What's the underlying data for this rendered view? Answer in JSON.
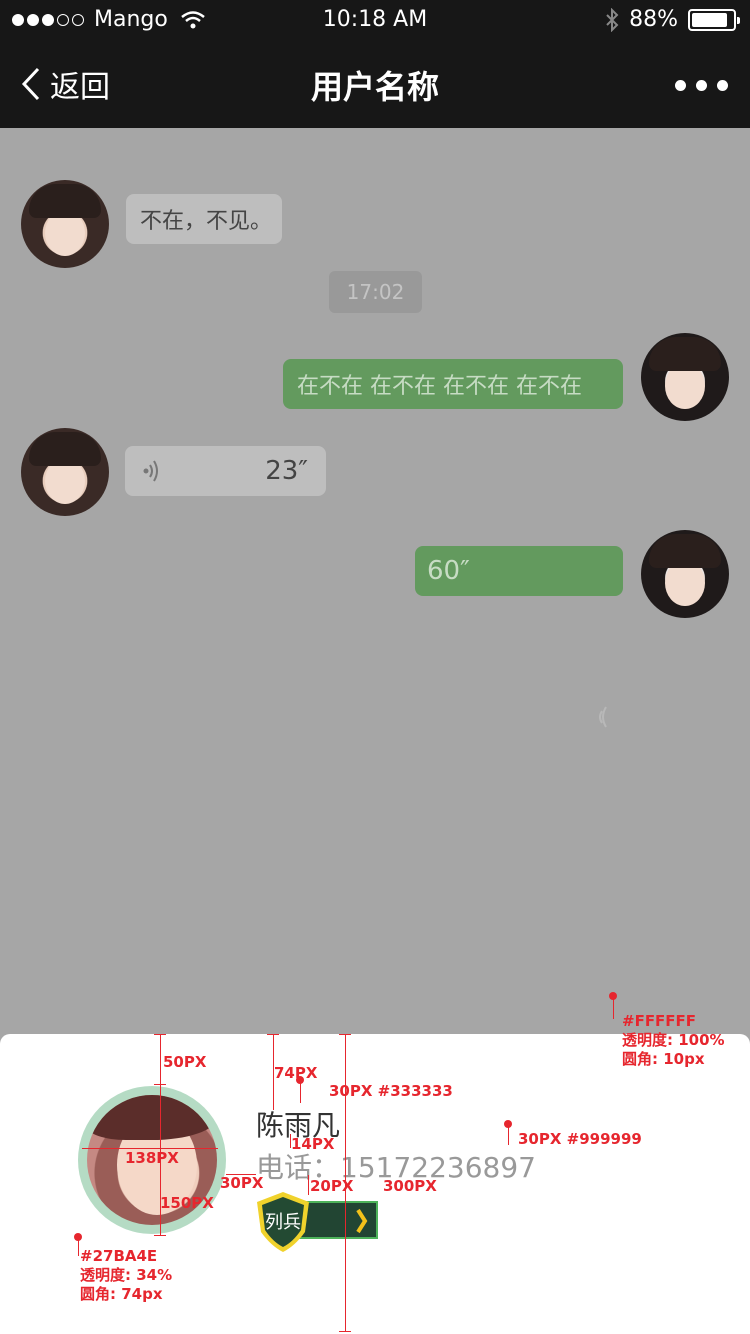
{
  "status_bar": {
    "carrier": "Mango",
    "signal_dots": [
      true,
      true,
      true,
      false,
      false
    ],
    "time": "10:18 AM",
    "battery": "88%",
    "battery_level": 0.88
  },
  "nav": {
    "back_label": "返回",
    "title": "用户名称"
  },
  "chat": {
    "timestamp": "17:02",
    "messages": [
      {
        "side": "in",
        "type": "text",
        "text": "不在，不见。"
      },
      {
        "side": "out",
        "type": "text",
        "text": "在不在 在不在 在不在 在不在"
      },
      {
        "side": "in",
        "type": "voice",
        "duration": "23″"
      },
      {
        "side": "out",
        "type": "voice",
        "duration": "60″"
      }
    ]
  },
  "profile_card": {
    "name": "陈雨凡",
    "phone": "电话：15172236897",
    "rank_label": "列兵"
  },
  "annotations": {
    "card_bg": [
      "#FFFFFF",
      "透明度: 100%",
      "圆角: 10px"
    ],
    "ring": [
      "#27BA4E",
      "透明度: 34%",
      "圆角: 74px"
    ],
    "name_spec": "30PX #333333",
    "phone_spec": "30PX #999999",
    "top_gap": "50PX",
    "name_gap": "74PX",
    "line_gap": "14PX",
    "rank_gap": "20PX",
    "rank_width": "300PX",
    "avatar_gap": "30PX",
    "photo_size": "138PX",
    "ring_size": "150PX"
  },
  "colors": {
    "topbar": "#171717",
    "overlay": "#a6a6a6",
    "bubble_out": "#639a5e",
    "bubble_in": "#bebebe",
    "annotation": "#e6262e",
    "rank_border": "#4db25a"
  }
}
